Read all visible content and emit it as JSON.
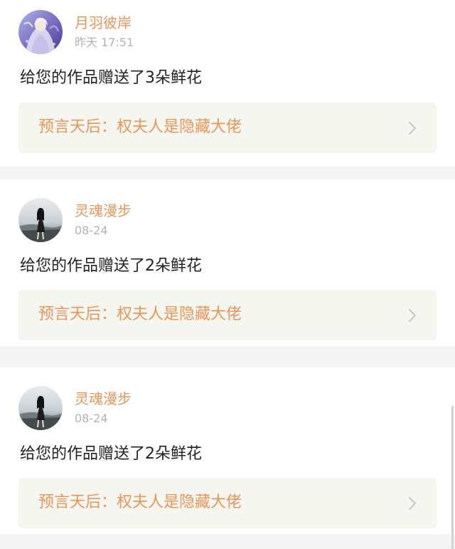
{
  "notifications": [
    {
      "username": "月羽彼岸",
      "time": "昨天 17:51",
      "message": "给您的作品赠送了3朵鲜花",
      "work_title": "预言天后：权夫人是隐藏大佬",
      "avatar": "anime-girl-avatar"
    },
    {
      "username": "灵魂漫步",
      "time": "08-24",
      "message": "给您的作品赠送了2朵鲜花",
      "work_title": "预言天后：权夫人是隐藏大佬",
      "avatar": "girl-by-water-avatar"
    },
    {
      "username": "灵魂漫步",
      "time": "08-24",
      "message": "给您的作品赠送了2朵鲜花",
      "work_title": "预言天后：权夫人是隐藏大佬",
      "avatar": "girl-by-water-avatar"
    }
  ],
  "icons": {
    "chevron": "chevron-right-icon"
  },
  "colors": {
    "accent": "#e8955a",
    "muted": "#b3b3b3",
    "text": "#222222",
    "link_bg": "#f6f6f1",
    "page_bg": "#f4f4f4"
  }
}
